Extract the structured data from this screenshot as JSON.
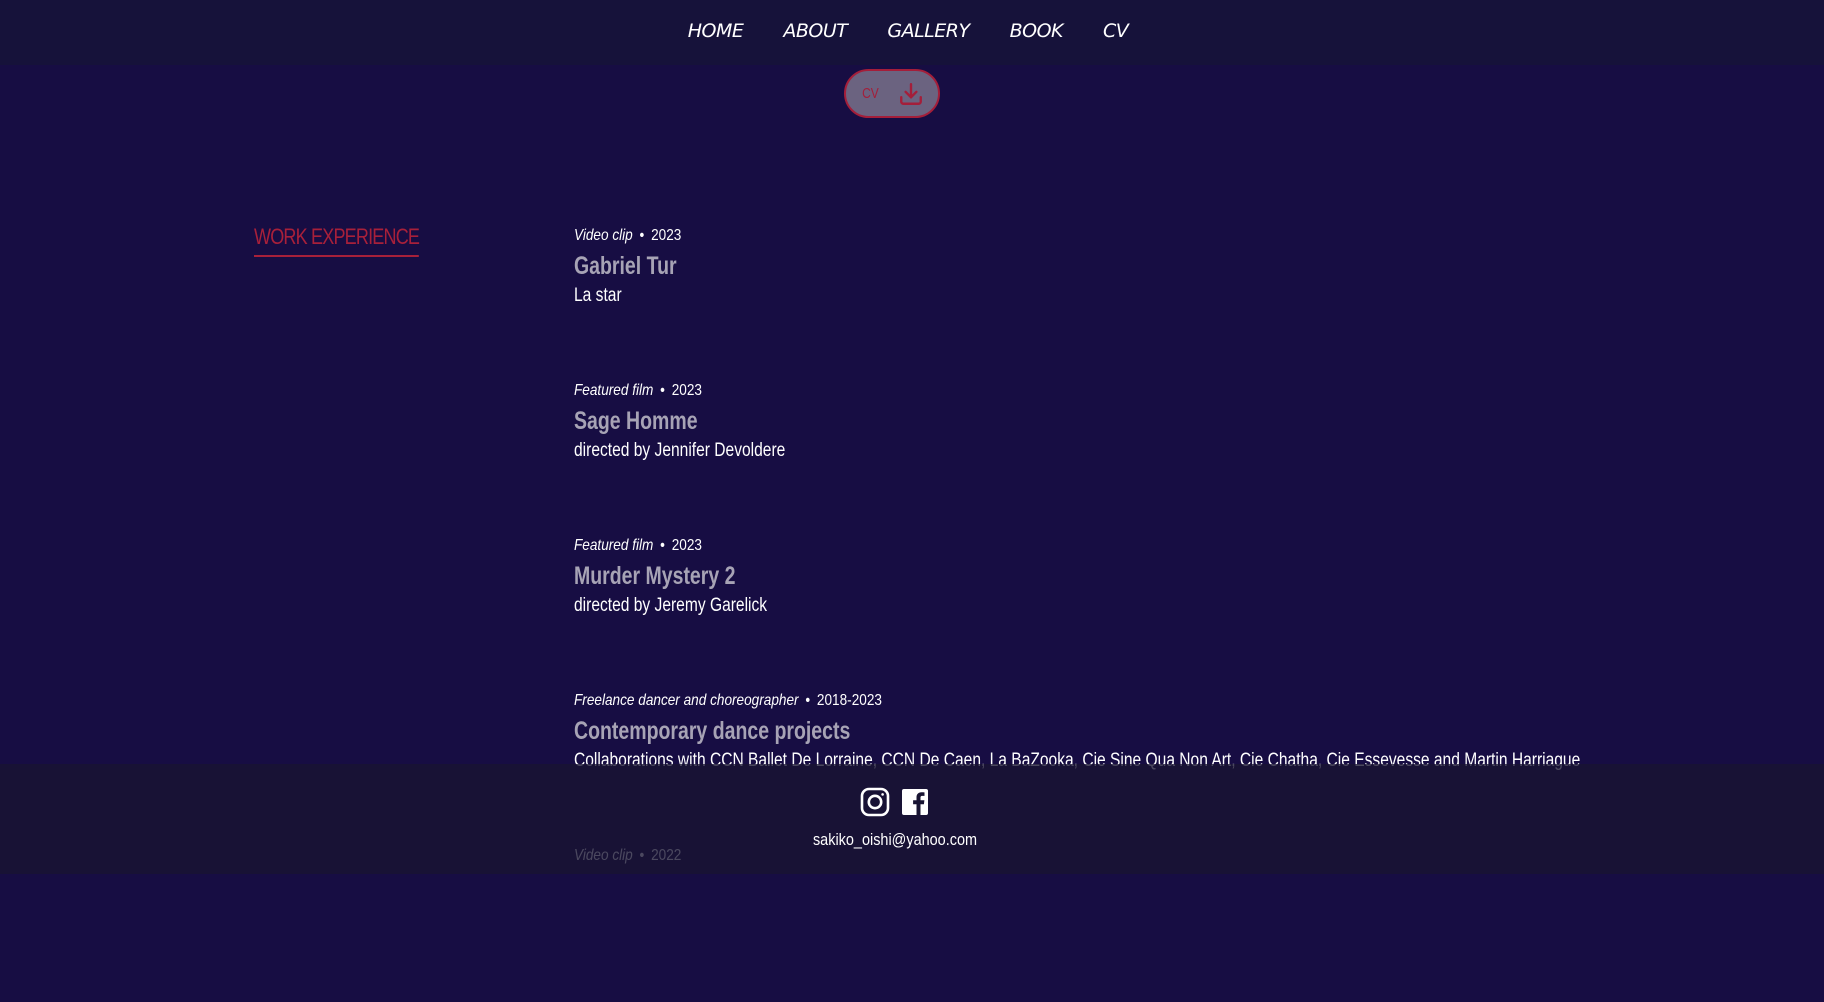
{
  "nav": {
    "items": [
      {
        "label": "HOME"
      },
      {
        "label": "ABOUT"
      },
      {
        "label": "GALLERY"
      },
      {
        "label": "BOOK"
      },
      {
        "label": "CV"
      }
    ]
  },
  "cv_download": {
    "label": "CV",
    "icon": "download-icon"
  },
  "section": {
    "title": "WORK EXPERIENCE"
  },
  "entries": [
    {
      "kind": "Video clip",
      "year": "2023",
      "title": "Gabriel Tur",
      "description": "La star"
    },
    {
      "kind": "Featured film",
      "year": "2023",
      "title": "Sage Homme",
      "description": "directed by Jennifer Devoldere"
    },
    {
      "kind": "Featured film",
      "year": "2023",
      "title": "Murder Mystery 2",
      "description": "directed by Jeremy Garelick"
    },
    {
      "kind": "Freelance dancer and choreographer",
      "year": "2018-2023",
      "title": "Contemporary dance projects",
      "description": "Collaborations with CCN Ballet De Lorraine, CCN De Caen, La BaZooka, Cie Sine Qua Non Art, Cie Chatha, Cie Essevesse and Martin Harriague"
    },
    {
      "kind": "Video clip",
      "year": "2022",
      "title": "",
      "description": ""
    }
  ],
  "entry_separator": "•",
  "footer": {
    "socials": [
      {
        "icon": "instagram-icon"
      },
      {
        "icon": "facebook-icon"
      }
    ],
    "email": "sakiko_oishi@yahoo.com"
  },
  "colors": {
    "background": "#170d43",
    "header": "#16123a",
    "accent": "#a8203a",
    "title_gray": "#a7a3b5",
    "button_fill": "#6b6380"
  }
}
